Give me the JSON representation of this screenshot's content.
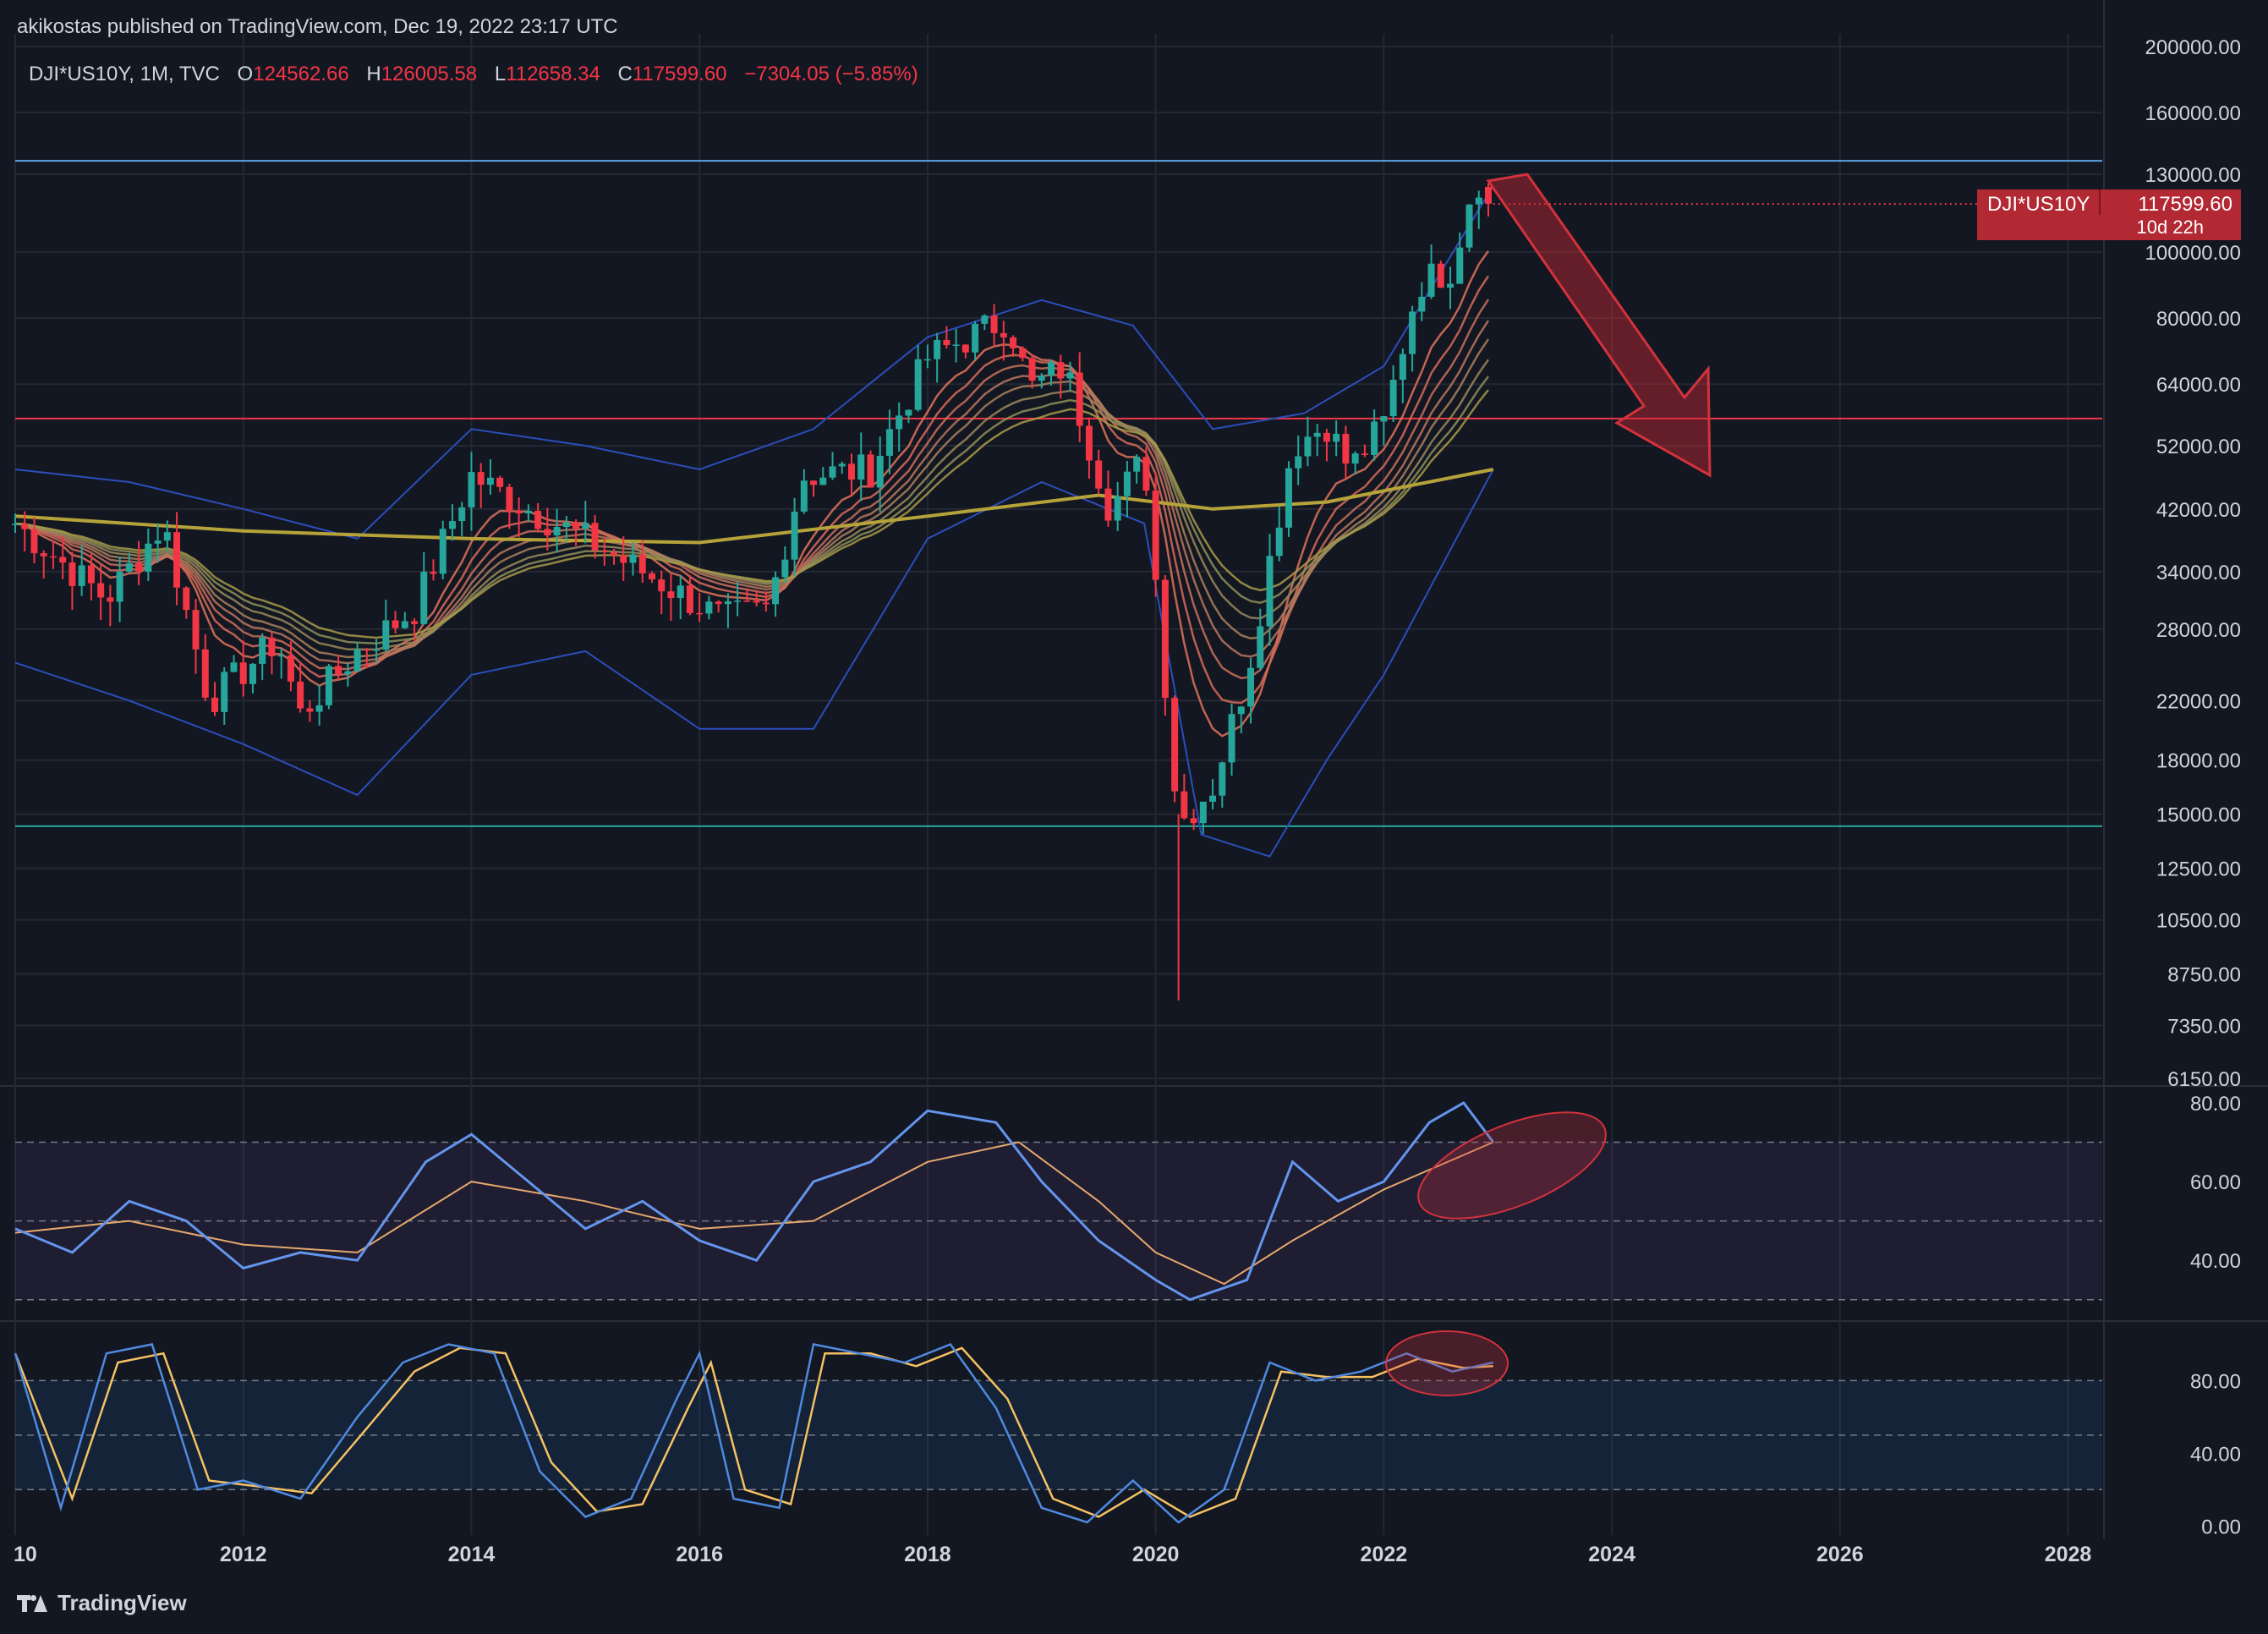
{
  "header": {
    "publisher": "akikostas published on TradingView.com, Dec 19, 2022 23:17 UTC"
  },
  "legend": {
    "symbol": "DJI*US10Y, 1M, TVC",
    "open_label": "O",
    "open": "124562.66",
    "high_label": "H",
    "high": "126005.58",
    "low_label": "L",
    "low": "112658.34",
    "close_label": "C",
    "close": "117599.60",
    "change": "−7304.05 (−5.85%)"
  },
  "price_label": {
    "symbol": "DJI*US10Y",
    "price": "117599.60",
    "countdown": "10d 22h"
  },
  "brand": {
    "name": "TradingView"
  },
  "colors": {
    "background": "#131722",
    "grid": "#242832",
    "up": "#26a69a",
    "down": "#f23645",
    "bollinger": "#2b4ebb",
    "ma200": "#b5a33a",
    "rsi": "#6495ed",
    "rsi_ma": "#e6a86c",
    "stoch_k": "#4f8ae0",
    "stoch_d": "#f5c163",
    "hline_top": "#5aa6e0",
    "hline_mid": "#f23645",
    "hline_bottom": "#26a69a",
    "annotation": "#d2323c"
  },
  "chart_data": [
    {
      "type": "candlestick",
      "scale": "log",
      "symbol": "DJI*US10Y",
      "interval": "1M",
      "ylim": [
        6150,
        200000
      ],
      "y_ticks": [
        6150,
        7350,
        8750,
        10500,
        12500,
        15000,
        18000,
        22000,
        28000,
        34000,
        42000,
        52000,
        64000,
        80000,
        100000,
        130000,
        160000,
        200000
      ],
      "y_tick_labels": [
        "6150.00",
        "7350.00",
        "8750.00",
        "10500.00",
        "12500.00",
        "15000.00",
        "18000.00",
        "22000.00",
        "28000.00",
        "34000.00",
        "42000.00",
        "52000.00",
        "64000.00",
        "80000.00",
        "100000.00",
        "130000.00",
        "160000.00",
        "200000.00"
      ],
      "x_ticks": [
        2010,
        2012,
        2014,
        2016,
        2018,
        2020,
        2022,
        2024,
        2026,
        2028
      ],
      "x_tick_labels": [
        "10",
        "2012",
        "2014",
        "2016",
        "2018",
        "2020",
        "2022",
        "2024",
        "2026",
        "2028"
      ],
      "xlim": [
        2010.0,
        2028.3
      ],
      "horizontal_lines": [
        136000,
        57000,
        14400
      ],
      "last": {
        "open": 124562.66,
        "high": 126005.58,
        "low": 112658.34,
        "close": 117599.6
      },
      "keypoints": [
        {
          "x": 2010.0,
          "y": 40000
        },
        {
          "x": 2010.8,
          "y": 31000
        },
        {
          "x": 2011.3,
          "y": 40000
        },
        {
          "x": 2011.7,
          "y": 22000
        },
        {
          "x": 2012.3,
          "y": 27000
        },
        {
          "x": 2012.5,
          "y": 21000
        },
        {
          "x": 2013.0,
          "y": 26000
        },
        {
          "x": 2013.5,
          "y": 30000
        },
        {
          "x": 2014.0,
          "y": 47000
        },
        {
          "x": 2014.5,
          "y": 42000
        },
        {
          "x": 2015.0,
          "y": 38000
        },
        {
          "x": 2015.5,
          "y": 34000
        },
        {
          "x": 2016.2,
          "y": 29000
        },
        {
          "x": 2016.6,
          "y": 30000
        },
        {
          "x": 2016.9,
          "y": 47000
        },
        {
          "x": 2017.5,
          "y": 48000
        },
        {
          "x": 2018.0,
          "y": 70000
        },
        {
          "x": 2018.7,
          "y": 80000
        },
        {
          "x": 2018.9,
          "y": 63000
        },
        {
          "x": 2019.2,
          "y": 68000
        },
        {
          "x": 2019.6,
          "y": 42000
        },
        {
          "x": 2019.9,
          "y": 50000
        },
        {
          "x": 2020.2,
          "y": 14500
        },
        {
          "x": 2020.5,
          "y": 16500
        },
        {
          "x": 2020.8,
          "y": 24000
        },
        {
          "x": 2021.2,
          "y": 52000
        },
        {
          "x": 2021.5,
          "y": 56000
        },
        {
          "x": 2021.7,
          "y": 48000
        },
        {
          "x": 2022.0,
          "y": 56000
        },
        {
          "x": 2022.3,
          "y": 90000
        },
        {
          "x": 2022.6,
          "y": 95000
        },
        {
          "x": 2022.8,
          "y": 130000
        },
        {
          "x": 2022.96,
          "y": 117599.6
        }
      ],
      "moving_average_200": [
        {
          "x": 2010.0,
          "y": 41000
        },
        {
          "x": 2012.0,
          "y": 39000
        },
        {
          "x": 2014.0,
          "y": 38000
        },
        {
          "x": 2016.0,
          "y": 37500
        },
        {
          "x": 2018.0,
          "y": 41000
        },
        {
          "x": 2019.5,
          "y": 44000
        },
        {
          "x": 2020.5,
          "y": 42000
        },
        {
          "x": 2021.5,
          "y": 43000
        },
        {
          "x": 2022.96,
          "y": 48000
        }
      ],
      "bollinger_upper": [
        {
          "x": 2010.0,
          "y": 48000
        },
        {
          "x": 2011.0,
          "y": 46000
        },
        {
          "x": 2012.0,
          "y": 42000
        },
        {
          "x": 2013.0,
          "y": 38000
        },
        {
          "x": 2014.0,
          "y": 55000
        },
        {
          "x": 2015.0,
          "y": 52000
        },
        {
          "x": 2016.0,
          "y": 48000
        },
        {
          "x": 2017.0,
          "y": 55000
        },
        {
          "x": 2018.0,
          "y": 75000
        },
        {
          "x": 2019.0,
          "y": 85000
        },
        {
          "x": 2019.8,
          "y": 78000
        },
        {
          "x": 2020.5,
          "y": 55000
        },
        {
          "x": 2021.3,
          "y": 58000
        },
        {
          "x": 2022.0,
          "y": 68000
        },
        {
          "x": 2022.96,
          "y": 125000
        }
      ],
      "bollinger_lower": [
        {
          "x": 2010.0,
          "y": 25000
        },
        {
          "x": 2011.0,
          "y": 22000
        },
        {
          "x": 2012.0,
          "y": 19000
        },
        {
          "x": 2013.0,
          "y": 16000
        },
        {
          "x": 2014.0,
          "y": 24000
        },
        {
          "x": 2015.0,
          "y": 26000
        },
        {
          "x": 2016.0,
          "y": 20000
        },
        {
          "x": 2017.0,
          "y": 20000
        },
        {
          "x": 2018.0,
          "y": 38000
        },
        {
          "x": 2019.0,
          "y": 46000
        },
        {
          "x": 2019.9,
          "y": 40000
        },
        {
          "x": 2020.4,
          "y": 14000
        },
        {
          "x": 2021.0,
          "y": 13000
        },
        {
          "x": 2021.5,
          "y": 18000
        },
        {
          "x": 2022.0,
          "y": 24000
        },
        {
          "x": 2022.96,
          "y": 48000
        }
      ]
    },
    {
      "type": "line",
      "indicator": "RSI",
      "ylim": [
        25,
        83
      ],
      "y_ticks": [
        40,
        60,
        80
      ],
      "y_tick_labels": [
        "40.00",
        "60.00",
        "80.00"
      ],
      "bands": [
        30,
        50,
        70
      ],
      "series": [
        {
          "values_x": [
            2010.0,
            2010.5,
            2011.0,
            2011.5,
            2012.0,
            2012.5,
            2013.0,
            2013.6,
            2014.0,
            2014.5,
            2015.0,
            2015.5,
            2016.0,
            2016.5,
            2017.0,
            2017.5,
            2018.0,
            2018.6,
            2019.0,
            2019.5,
            2020.0,
            2020.3,
            2020.8,
            2021.2,
            2021.6,
            2022.0,
            2022.4,
            2022.7,
            2022.96
          ],
          "values": [
            48,
            42,
            55,
            50,
            38,
            42,
            40,
            65,
            72,
            60,
            48,
            55,
            45,
            40,
            60,
            65,
            78,
            75,
            60,
            45,
            35,
            30,
            35,
            65,
            55,
            60,
            75,
            80,
            70
          ]
        },
        {
          "values_x": [
            2010.0,
            2011.0,
            2012.0,
            2013.0,
            2014.0,
            2015.0,
            2016.0,
            2017.0,
            2018.0,
            2018.8,
            2019.5,
            2020.0,
            2020.6,
            2021.2,
            2022.0,
            2022.96
          ],
          "values": [
            47,
            50,
            44,
            42,
            60,
            55,
            48,
            50,
            65,
            70,
            55,
            42,
            34,
            45,
            58,
            70
          ]
        }
      ]
    },
    {
      "type": "line",
      "indicator": "Stochastic",
      "ylim": [
        -5,
        110
      ],
      "y_ticks": [
        0,
        40,
        80
      ],
      "y_tick_labels": [
        "0.00",
        "40.00",
        "80.00"
      ],
      "bands": [
        20,
        50,
        80
      ],
      "series": [
        {
          "values_x": [
            2010.0,
            2010.4,
            2010.8,
            2011.2,
            2011.6,
            2012.0,
            2012.5,
            2013.0,
            2013.4,
            2013.8,
            2014.2,
            2014.6,
            2015.0,
            2015.4,
            2015.8,
            2016.0,
            2016.3,
            2016.7,
            2017.0,
            2017.4,
            2017.8,
            2018.2,
            2018.6,
            2019.0,
            2019.4,
            2019.8,
            2020.2,
            2020.6,
            2021.0,
            2021.4,
            2021.8,
            2022.2,
            2022.6,
            2022.96
          ],
          "values": [
            95,
            10,
            95,
            100,
            20,
            25,
            15,
            60,
            90,
            100,
            95,
            30,
            5,
            15,
            70,
            95,
            15,
            10,
            100,
            95,
            90,
            100,
            65,
            10,
            2,
            25,
            2,
            20,
            90,
            80,
            85,
            95,
            85,
            90
          ]
        },
        {
          "values_x": [
            2010.0,
            2010.5,
            2010.9,
            2011.3,
            2011.7,
            2012.1,
            2012.6,
            2013.1,
            2013.5,
            2013.9,
            2014.3,
            2014.7,
            2015.1,
            2015.5,
            2015.9,
            2016.1,
            2016.4,
            2016.8,
            2017.1,
            2017.5,
            2017.9,
            2018.3,
            2018.7,
            2019.1,
            2019.5,
            2019.9,
            2020.3,
            2020.7,
            2021.1,
            2021.5,
            2021.9,
            2022.3,
            2022.7,
            2022.96
          ],
          "values": [
            95,
            15,
            90,
            95,
            25,
            22,
            18,
            55,
            85,
            98,
            95,
            35,
            8,
            12,
            65,
            90,
            20,
            12,
            95,
            95,
            88,
            98,
            70,
            15,
            5,
            20,
            5,
            15,
            85,
            82,
            82,
            92,
            87,
            88
          ]
        }
      ]
    }
  ]
}
